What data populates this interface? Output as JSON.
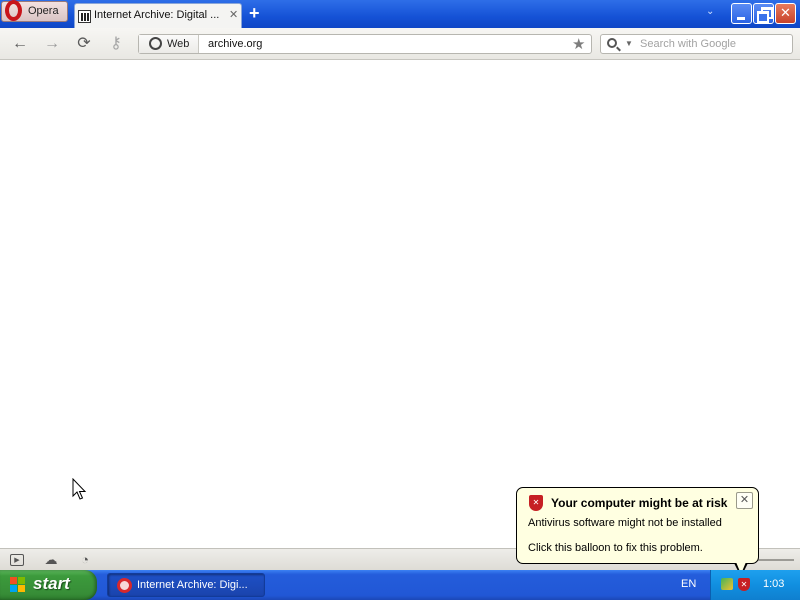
{
  "browser": {
    "menu_label": "Opera",
    "tabs": [
      {
        "title": "Internet Archive: Digital ...",
        "close_glyph": "✕"
      }
    ],
    "new_tab_glyph": "+",
    "tab_list_glyph": "⌄",
    "icons": {
      "back": "back-arrow-icon",
      "forward": "forward-arrow-icon",
      "reload": "reload-icon",
      "wand": "key-wand-icon",
      "globe": "globe-icon",
      "star": "star-bookmark-icon",
      "search": "magnifier-icon"
    },
    "nav_glyphs": {
      "back": "←",
      "forward": "→",
      "reload": "⟳",
      "wand": "⚷",
      "star": "★",
      "dropdown": "▼"
    },
    "address": {
      "badge": "Web",
      "value": "archive.org"
    },
    "search": {
      "placeholder": "Search with Google"
    }
  },
  "balloon": {
    "title": "Your computer might be at risk",
    "line1": "Antivirus software might not be installed",
    "line2": "Click this balloon to fix this problem.",
    "close_glyph": "✕",
    "shield_glyph": "✕"
  },
  "taskbar": {
    "start_label": "start",
    "window_title": "Internet Archive: Digi...",
    "language": "EN",
    "clock": "1:03"
  },
  "colors": {
    "tabbar": "#1552d6",
    "taskbar": "#245ddb",
    "start_green": "#3c9a3c",
    "balloon_bg": "#ffffe1",
    "opera_red": "#c8141b"
  }
}
